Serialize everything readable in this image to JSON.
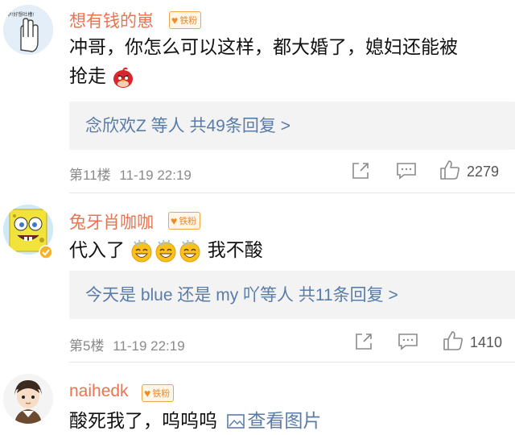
{
  "comments": [
    {
      "username": "想有钱的崽",
      "badge": "铁粉",
      "avatar_text": "咿!好想吐槽!",
      "text": "冲哥，你怎么可以这样，都大婚了，媳妇还能被抢走",
      "text_line1": "冲哥，你怎么可以这样，都大婚了，媳妇还能被",
      "text_line2": "抢走",
      "replies": "念欣欢Z 等人  共49条回复 >",
      "floor": "第11楼",
      "time": "11-19 22:19",
      "likes": "2279"
    },
    {
      "username": "兔牙肖咖咖",
      "badge": "铁粉",
      "text_before": "代入了",
      "text_after": "我不酸",
      "replies": "今天是 blue 还是 my 吖等人  共11条回复 >",
      "floor": "第5楼",
      "time": "11-19 22:19",
      "likes": "1410"
    },
    {
      "username": "naihedk",
      "badge": "铁粉",
      "text": "酸死我了，呜呜呜",
      "view_image": "查看图片"
    }
  ],
  "colors": {
    "username": "#eb7350",
    "link": "#5a7ca8",
    "meta": "#8a8a8a",
    "reply_bg": "#f3f3f3"
  },
  "icons": [
    "fan-heart-icon",
    "share-icon",
    "comment-icon",
    "like-icon",
    "image-icon",
    "angry-bird-emoji",
    "sweat-smile-emoji"
  ]
}
